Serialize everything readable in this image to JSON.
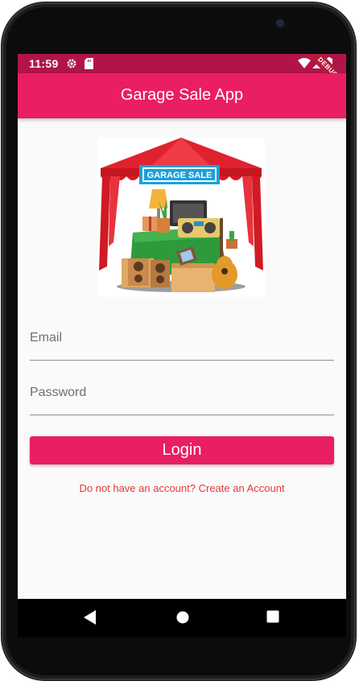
{
  "status_bar": {
    "time": "11:59",
    "debug_label": "DEBUG"
  },
  "app_bar": {
    "title": "Garage Sale App"
  },
  "logo": {
    "banner_text": "GARAGE SALE"
  },
  "form": {
    "email_label": "Email",
    "password_label": "Password",
    "login_label": "Login",
    "signup_link": "Do not have an account? Create an Account"
  },
  "icons": {
    "status": [
      "settings-icon",
      "sd-card-icon",
      "wifi-icon",
      "signal-icon",
      "battery-icon"
    ],
    "nav": [
      "back-icon",
      "home-icon",
      "recents-icon"
    ]
  },
  "colors": {
    "primary": "#e91e63",
    "status_bar": "#b0144a",
    "link": "#e53935",
    "background": "#fafafa"
  }
}
